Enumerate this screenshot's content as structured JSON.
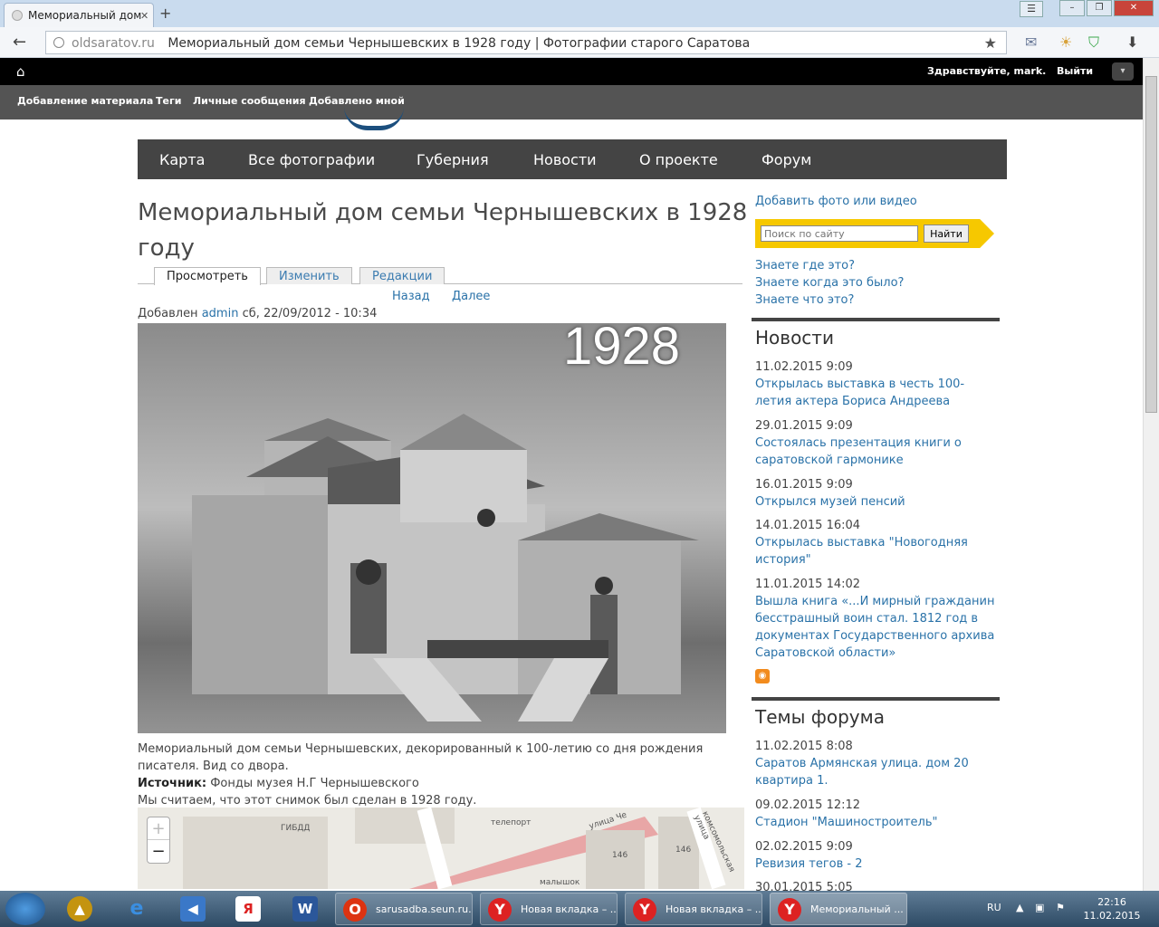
{
  "browser": {
    "tab_title": "Мемориальный дом",
    "url_domain": "oldsaratov.ru",
    "page_title": "Мемориальный дом семьи Чернышевских в 1928 году | Фотографии старого Саратова"
  },
  "adminbar": {
    "greeting": "Здравствуйте, mark.",
    "logout": "Выйти",
    "shortcuts": [
      "Добавление материала",
      "Теги",
      "Личные сообщения",
      "Добавлено мной"
    ]
  },
  "nav": [
    "Карта",
    "Все фотографии",
    "Губерния",
    "Новости",
    "О проекте",
    "Форум"
  ],
  "node": {
    "title": "Мемориальный дом семьи Чернышевских в 1928 году",
    "tabs": [
      "Просмотреть",
      "Изменить",
      "Редакции"
    ],
    "prev": "Назад",
    "next": "Далее",
    "submitted_prefix": "Добавлен",
    "author": "admin",
    "date": "сб, 22/09/2012 - 10:34",
    "photo_year": "1928",
    "caption": "Мемориальный дом семьи Чернышевских, декорированный к 100-летию со дня рождения писателя. Вид со двора.",
    "source_label": "Источник:",
    "source": "Фонды музея Н.Г Чернышевского",
    "dating": "Мы считаем, что этот снимок был сделан в 1928 году."
  },
  "map": {
    "zoom_in": "+",
    "zoom_out": "−",
    "labels": [
      "ГИБДД",
      "телепорт",
      "улица Че",
      "комсомольская улица",
      "146",
      "146",
      "малышок"
    ]
  },
  "sidebar": {
    "add_media": "Добавить фото или видео",
    "search_placeholder": "Поиск по сайту",
    "search_button": "Найти",
    "quiz": [
      "Знаете где это?",
      "Знаете когда это было?",
      "Знаете что это?"
    ],
    "news_title": "Новости",
    "news": [
      {
        "date": "11.02.2015 9:09",
        "title": "Открылась выставка в честь 100-летия актера Бориса Андреева"
      },
      {
        "date": "29.01.2015 9:09",
        "title": "Состоялась презентация книги о саратовской гармонике"
      },
      {
        "date": "16.01.2015 9:09",
        "title": "Открылся музей пенсий"
      },
      {
        "date": "14.01.2015 16:04",
        "title": "Открылась выставка \"Новогодняя история\""
      },
      {
        "date": "11.01.2015 14:02",
        "title": "Вышла книга «...И мирный гражданин бесстрашный воин стал. 1812 год в документах Государственного архива Саратовской области»"
      }
    ],
    "forum_title": "Темы форума",
    "forum": [
      {
        "date": "11.02.2015 8:08",
        "title": "Саратов Армянская улица. дом 20 квартира 1."
      },
      {
        "date": "09.02.2015 12:12",
        "title": "Стадион \"Машиностроитель\""
      },
      {
        "date": "02.02.2015 9:09",
        "title": "Ревизия тегов - 2"
      },
      {
        "date": "30.01.2015 5:05",
        "title": ""
      }
    ]
  },
  "taskbar": {
    "tasks": [
      "sarusadba.seun.ru...",
      "Новая вкладка – ...",
      "Новая вкладка – ...",
      "Мемориальный ..."
    ],
    "lang": "RU",
    "time": "22:16",
    "date": "11.02.2015"
  }
}
